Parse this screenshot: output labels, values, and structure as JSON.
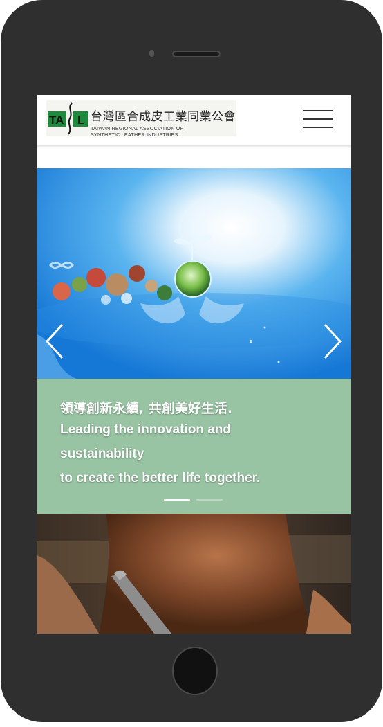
{
  "header": {
    "logo": {
      "mark_text": "TAIL",
      "title_zh": "台灣區合成皮工業同業公會",
      "title_en_line1": "TAIWAN REGIONAL ASSOCIATION OF",
      "title_en_line2": "SYNTHETIC LEATHER INDUSTRIES"
    },
    "menu_icon": "hamburger-menu-icon"
  },
  "hero": {
    "caption_zh": "領導創新永續, 共創美好生活.",
    "caption_en_line1": "Leading the innovation and",
    "caption_en_line2": "sustainability",
    "caption_en_line3": "to create the better life together.",
    "prev_icon": "chevron-left-icon",
    "next_icon": "chevron-right-icon",
    "slide_count": 2,
    "active_slide": 1
  },
  "colors": {
    "phone_frame": "#2f2f2f",
    "caption_background": "#98c4a3",
    "logo_green": "#1e8a3c",
    "sky_blue": "#1e8fe0"
  }
}
